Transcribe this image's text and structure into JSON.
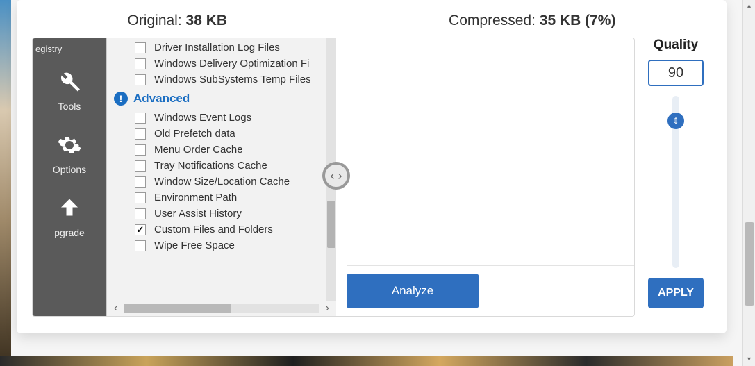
{
  "stats": {
    "original_label": "Original:",
    "original_value": "38 KB",
    "compressed_label": "Compressed:",
    "compressed_value": "35 KB (7%)"
  },
  "sidebar": {
    "top_label": "egistry",
    "items": [
      {
        "label": "Tools"
      },
      {
        "label": "Options"
      },
      {
        "label": "pgrade"
      }
    ]
  },
  "tree": {
    "pre_items": [
      {
        "label": "Driver Installation Log Files",
        "checked": false
      },
      {
        "label": "Windows Delivery Optimization Fi",
        "checked": false
      },
      {
        "label": "Windows SubSystems Temp Files",
        "checked": false
      }
    ],
    "category": "Advanced",
    "adv_items": [
      {
        "label": "Windows Event Logs",
        "checked": false
      },
      {
        "label": "Old Prefetch data",
        "checked": false
      },
      {
        "label": "Menu Order Cache",
        "checked": false
      },
      {
        "label": "Tray Notifications Cache",
        "checked": false
      },
      {
        "label": "Window Size/Location Cache",
        "checked": false
      },
      {
        "label": "Environment Path",
        "checked": false
      },
      {
        "label": "User Assist History",
        "checked": false
      },
      {
        "label": "Custom Files and Folders",
        "checked": true
      },
      {
        "label": "Wipe Free Space",
        "checked": false
      }
    ]
  },
  "analyze_label": "Analyze",
  "quality": {
    "title": "Quality",
    "value": "90",
    "apply_label": "APPLY"
  }
}
